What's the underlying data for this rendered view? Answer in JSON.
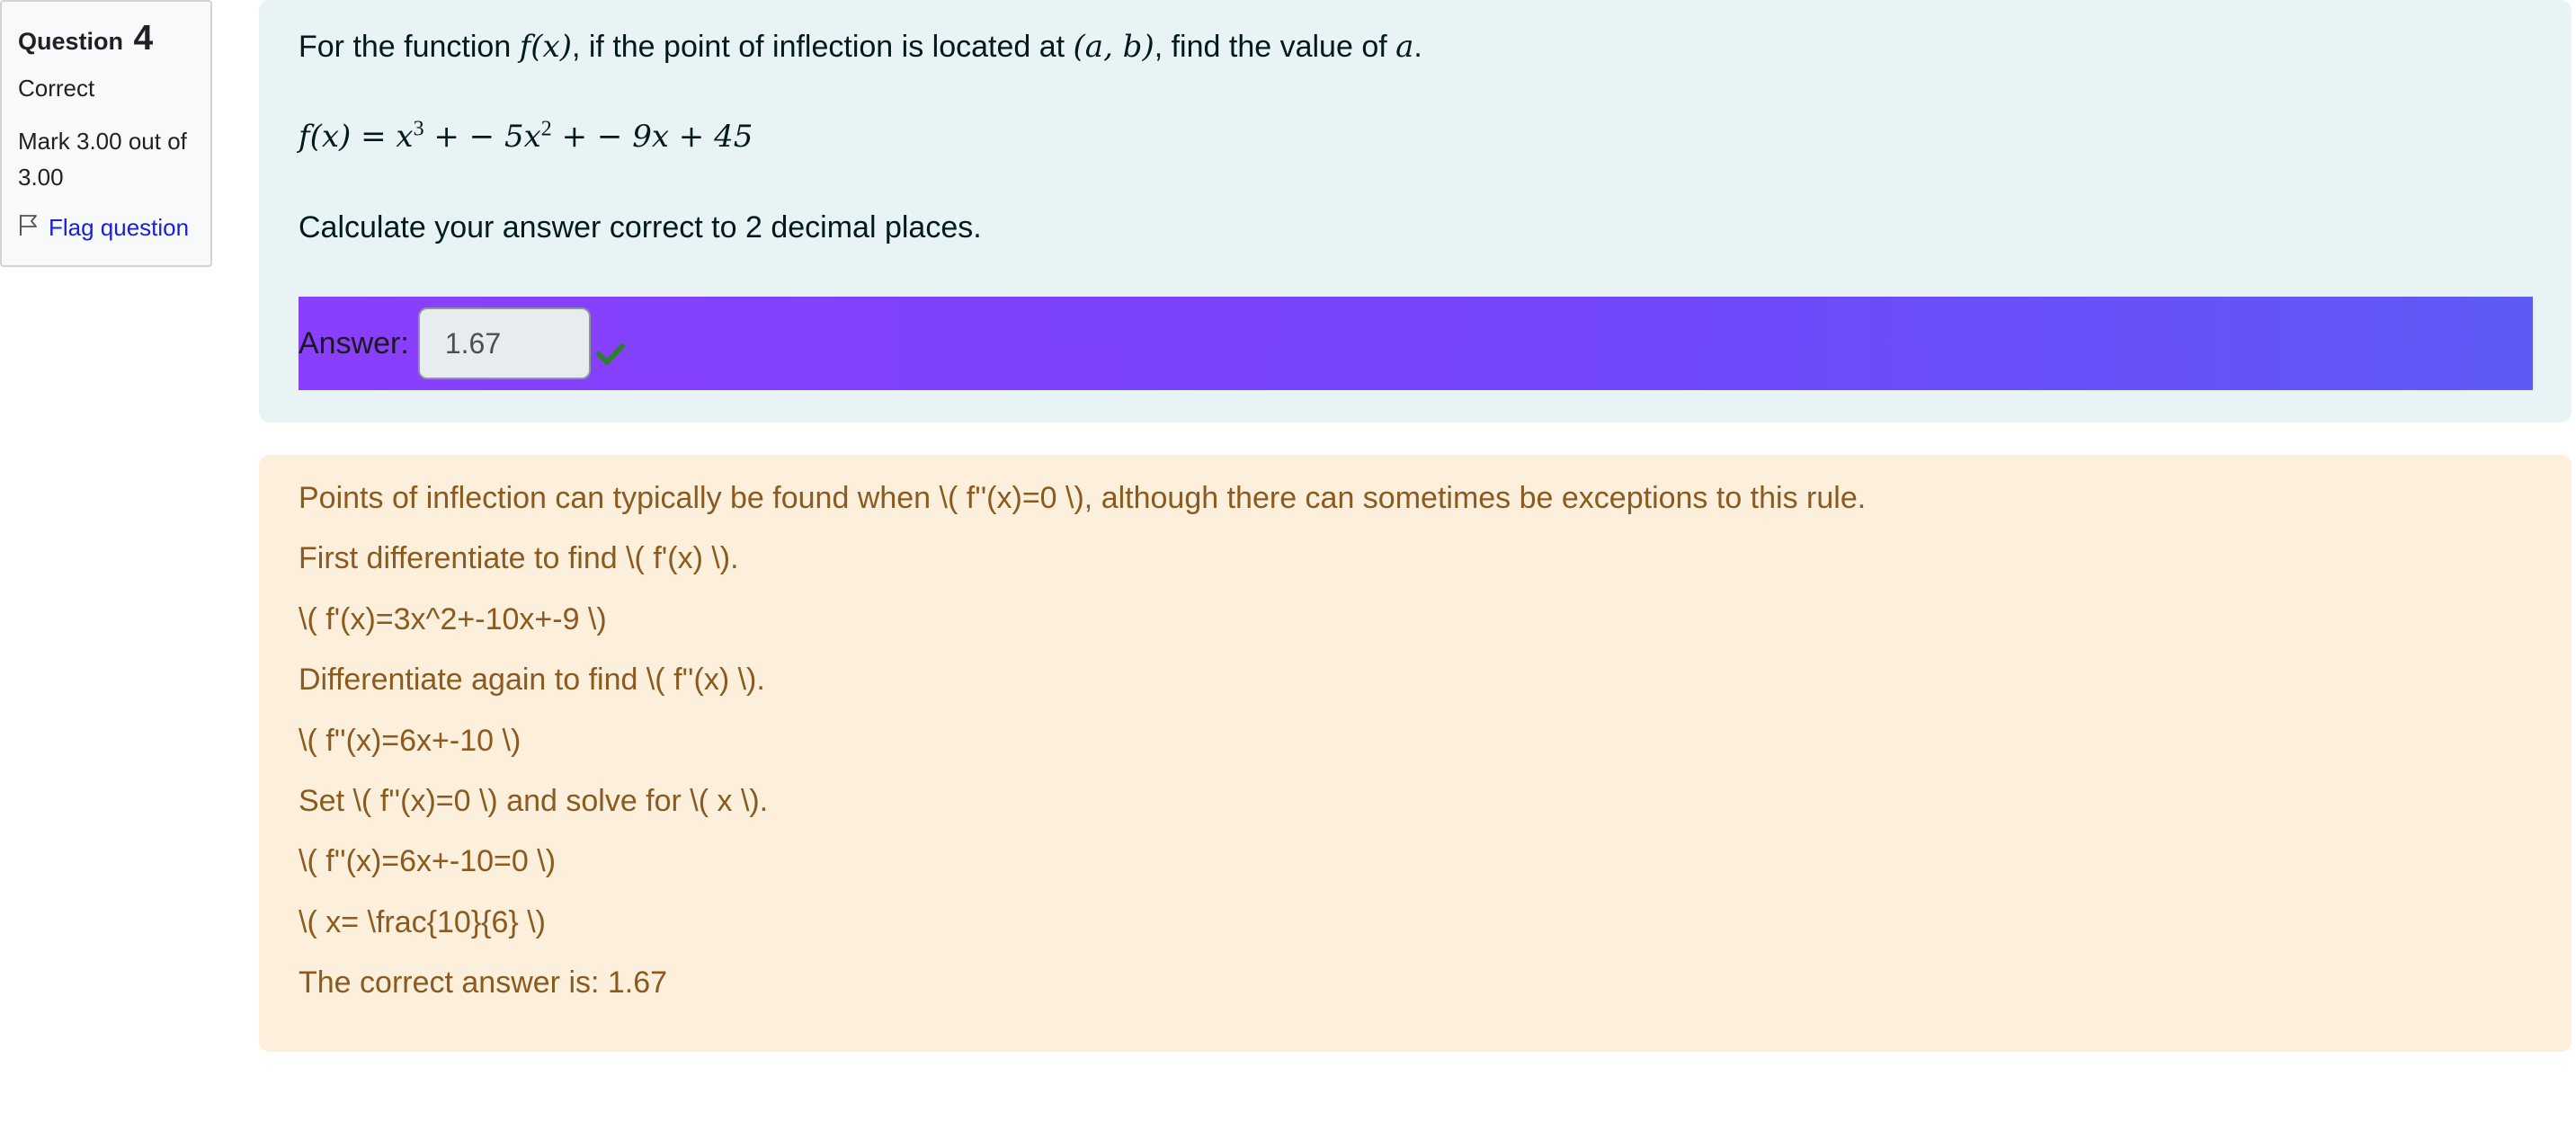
{
  "info": {
    "question_label": "Question",
    "question_number": "4",
    "state": "Correct",
    "grade": "Mark 3.00 out of 3.00",
    "flag_label": "Flag question"
  },
  "question": {
    "text_prefix": "For the function ",
    "text_fx": "f(x)",
    "text_mid": ", if the point of inflection is located at ",
    "text_point": "(a, b)",
    "text_mid2": ", find the value of ",
    "text_var": "a",
    "text_end": ".",
    "function_lhs": "f(x) = x",
    "function_exp1": "3",
    "function_mid": " + − 5x",
    "function_exp2": "2",
    "function_rest": " + − 9x + 45",
    "instruction": "Calculate your answer correct to 2 decimal places.",
    "answer_label": "Answer:",
    "answer_value": "1.67",
    "answer_status_icon": "check-icon"
  },
  "feedback": {
    "lines": [
      "Points of inflection can typically be found when \\( f''(x)=0 \\), although there can sometimes be exceptions to this rule.",
      "First differentiate to find \\( f'(x) \\).",
      "\\( f'(x)=3x^2+-10x+-9 \\)",
      "Differentiate again to find \\( f''(x) \\).",
      "\\( f''(x)=6x+-10 \\)",
      "Set \\( f''(x)=0 \\) and solve for \\( x \\).",
      "\\( f''(x)=6x+-10=0 \\)",
      "\\( x= \\frac{10}{6} \\)",
      "The correct answer is: 1.67"
    ]
  },
  "colors": {
    "feedback_text": "#8a5a1f",
    "feedback_bg": "#fcefdc",
    "question_bg": "#e7f3f5",
    "answer_gradient_start": "#8a3ffc",
    "answer_gradient_end": "#5e5af5",
    "correct_tick": "#2e7d32",
    "link": "#1a20d8"
  }
}
